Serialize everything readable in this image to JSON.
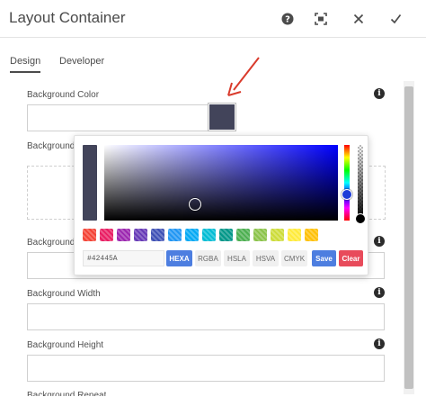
{
  "header": {
    "title": "Layout Container"
  },
  "tabs": [
    {
      "label": "Design"
    },
    {
      "label": "Developer"
    }
  ],
  "fields": {
    "background_color": {
      "label": "Background Color",
      "swatch_color": "#42445A"
    },
    "background_image": {
      "label": "Background"
    },
    "background_position": {
      "label": "Background"
    },
    "background_width": {
      "label": "Background Width",
      "value": ""
    },
    "background_height": {
      "label": "Background Height",
      "value": ""
    },
    "background_repeat": {
      "label": "Background Repeat"
    }
  },
  "color_picker": {
    "current_color": "#42445A",
    "hex_value": "#42445A",
    "modes": [
      "HEXA",
      "RGBA",
      "HSLA",
      "HSVA",
      "CMYK"
    ],
    "active_mode": "HEXA",
    "save_label": "Save",
    "clear_label": "Clear",
    "swatches": [
      "#f44336",
      "#e91e63",
      "#9c27b0",
      "#673ab7",
      "#3f51b5",
      "#2196f3",
      "#03a9f4",
      "#00bcd4",
      "#009688",
      "#4caf50",
      "#8bc34a",
      "#cddc39",
      "#ffeb3b",
      "#ffc107"
    ]
  },
  "colors": {
    "accent": "#4d7ee0",
    "clear": "#e84b5b",
    "annotation_arrow": "#d93a2b"
  }
}
